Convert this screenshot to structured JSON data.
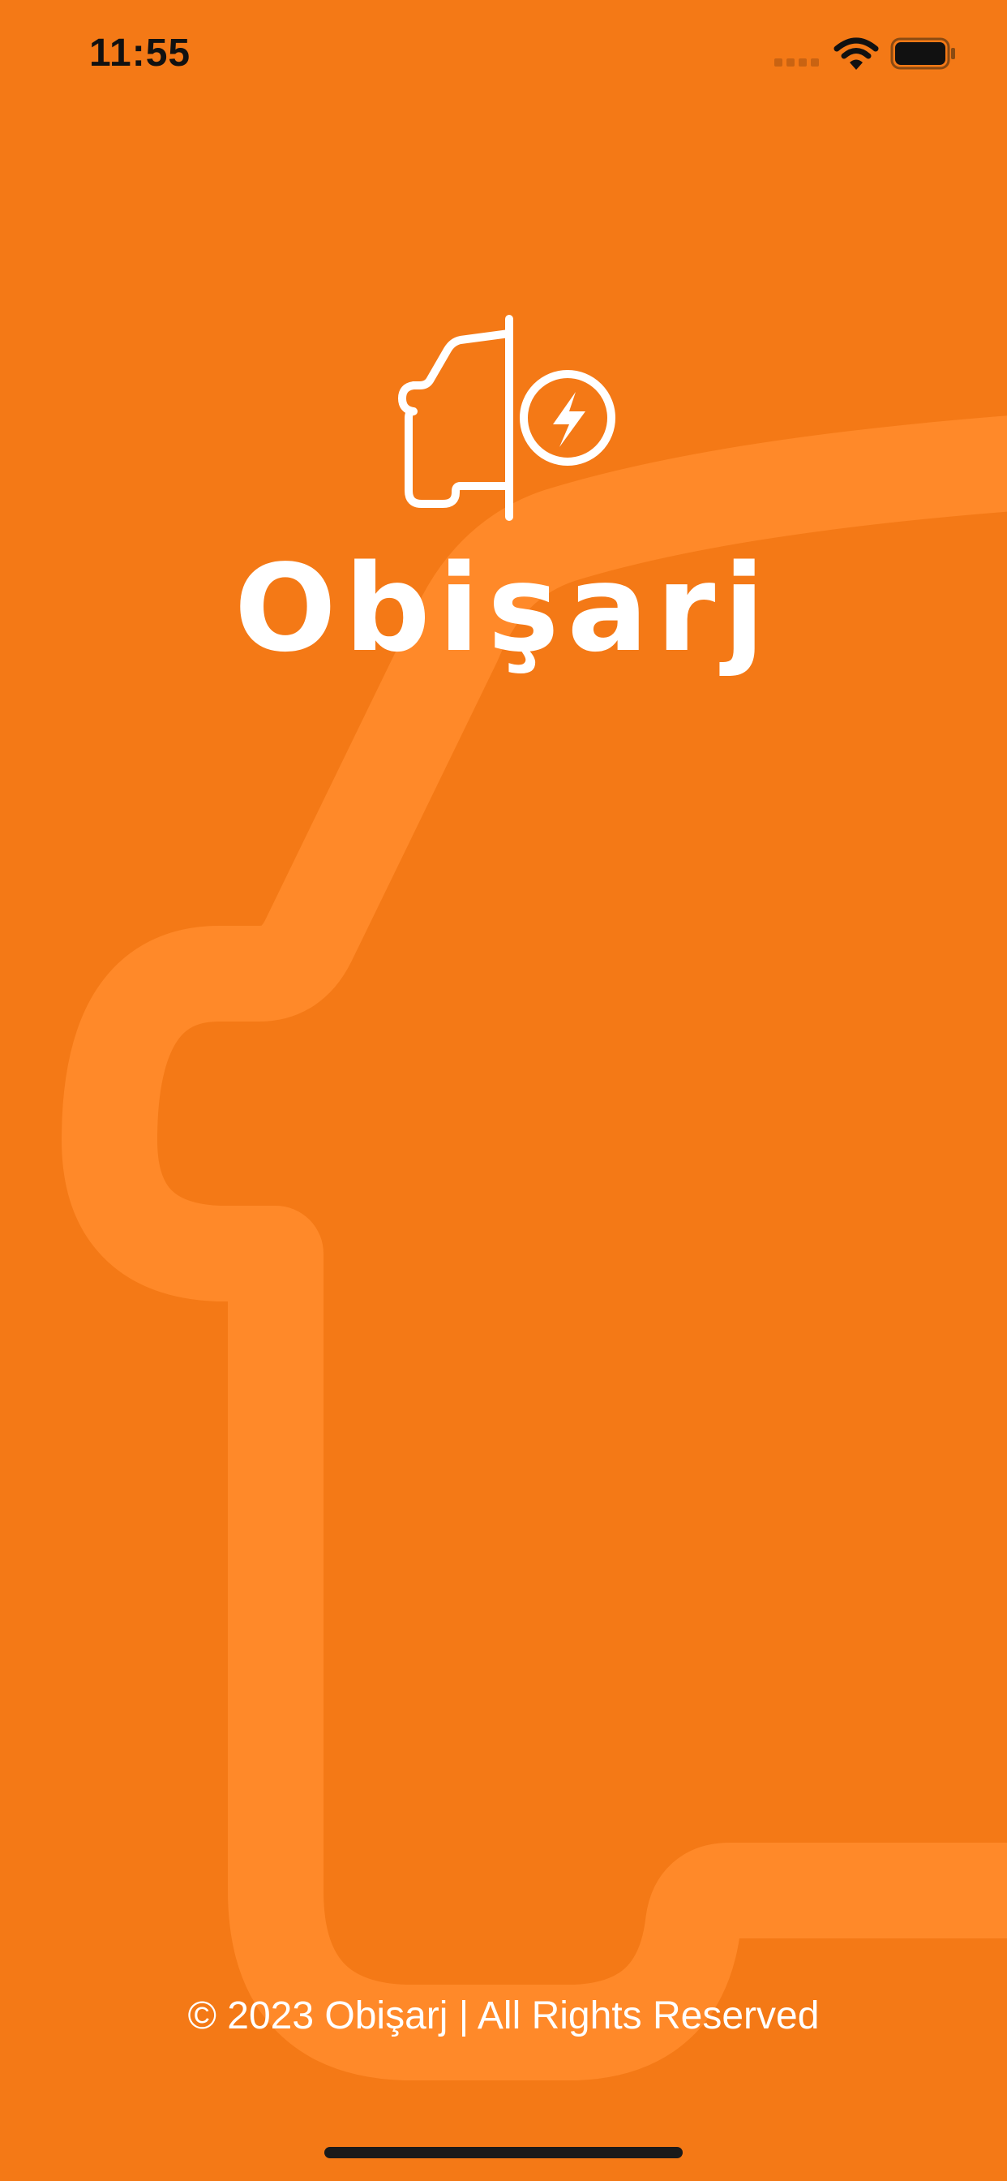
{
  "status_bar": {
    "time": "11:55",
    "icons": [
      "cellular-signal-icon",
      "wifi-icon",
      "battery-icon"
    ]
  },
  "splash": {
    "logo_icon": "car-charging-icon",
    "brand_name": "Obişarj",
    "footer": "© 2023 Obişarj |  All Rights Reserved"
  },
  "colors": {
    "background": "#F47916",
    "car_watermark": "#FF8A2A",
    "text": "#FFFFFF",
    "status_text": "#111111"
  }
}
